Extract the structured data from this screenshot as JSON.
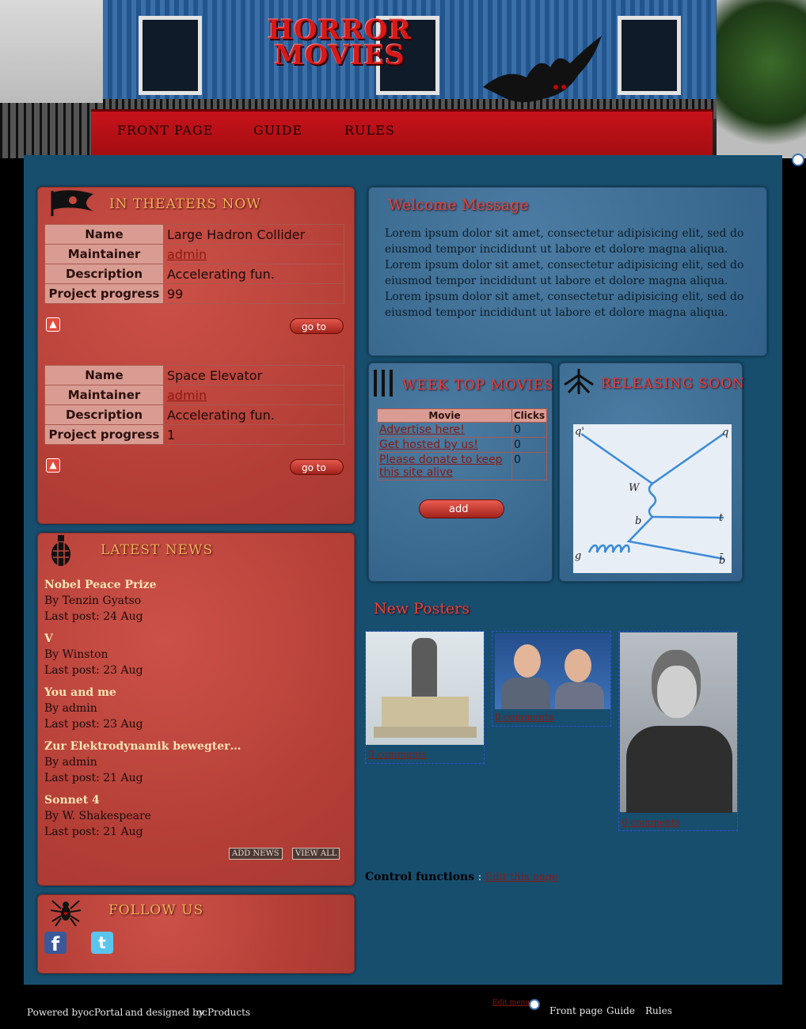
{
  "logo": {
    "line1": "HORROR",
    "line2": "MOVIES"
  },
  "nav": {
    "items": [
      "FRONT PAGE",
      "GUIDE",
      "RULES"
    ]
  },
  "theaters": {
    "title": "IN THEATERS NOW",
    "projects": [
      {
        "fields": [
          {
            "label": "Name",
            "value": "Large Hadron Collider"
          },
          {
            "label": "Maintainer",
            "value": "admin"
          },
          {
            "label": "Description",
            "value": "Accelerating fun."
          },
          {
            "label": "Project progress",
            "value": "99"
          }
        ]
      },
      {
        "fields": [
          {
            "label": "Name",
            "value": "Space Elevator"
          },
          {
            "label": "Maintainer",
            "value": "admin"
          },
          {
            "label": "Description",
            "value": "Accelerating fun."
          },
          {
            "label": "Project progress",
            "value": "1"
          }
        ]
      }
    ],
    "goto_label": "go to"
  },
  "news": {
    "title": "LATEST NEWS",
    "items": [
      {
        "title": "Nobel Peace Prize",
        "by": "By Tenzin Gyatso",
        "date": "Last post: 24 Aug"
      },
      {
        "title": "V",
        "by": "By Winston",
        "date": "Last post: 23 Aug"
      },
      {
        "title": "You and me",
        "by": "By admin",
        "date": "Last post: 23 Aug"
      },
      {
        "title": "Zur Elektrodynamik bewegter…",
        "by": "By admin",
        "date": "Last post: 21 Aug"
      },
      {
        "title": "Sonnet 4",
        "by": "By W. Shakespeare",
        "date": "Last post: 21 Aug"
      }
    ],
    "add_label": "ADD NEWS",
    "view_label": "VIEW ALL"
  },
  "follow": {
    "title": "FOLLOW US",
    "facebook": "f",
    "twitter": "t"
  },
  "welcome": {
    "title": "Welcome Message",
    "text": "Lorem ipsum dolor sit amet, consectetur adipisicing elit, sed do eiusmod tempor incididunt ut labore et dolore magna aliqua. Lorem ipsum dolor sit amet, consectetur adipisicing elit, sed do eiusmod tempor incididunt ut labore et dolore magna aliqua. Lorem ipsum dolor sit amet, consectetur adipisicing elit, sed do eiusmod tempor incididunt ut labore et dolore magna aliqua."
  },
  "week_top": {
    "title": "WEEK TOP MOVIES",
    "headers": [
      "Movie",
      "Clicks"
    ],
    "rows": [
      {
        "movie": "Advertise here!",
        "clicks": "0"
      },
      {
        "movie": "Get hosted by us!",
        "clicks": "0"
      },
      {
        "movie": "Please donate to keep this site alive",
        "clicks": "0"
      }
    ],
    "add_label": "add"
  },
  "releasing": {
    "title": "RELEASING SOON",
    "diagram_labels": {
      "q_prime": "q'",
      "q": "q",
      "w": "W",
      "b": "b",
      "t": "t",
      "g": "g",
      "b_bar": "b̄"
    }
  },
  "posters": {
    "title": "New Posters",
    "items": [
      {
        "comments": "0 comments"
      },
      {
        "comments": "0 comments"
      },
      {
        "comments": "0 comments"
      }
    ]
  },
  "control": {
    "label": "Control functions",
    "sep": ":",
    "link": "Edit this page"
  },
  "footer": {
    "powered": "Powered by",
    "ocportal": "ocPortal",
    "designed": "and designed by",
    "ocproducts": "ocProducts",
    "edit_menu": "Edit menu",
    "links": [
      "Front page",
      "Guide",
      "Rules"
    ]
  },
  "colors": {
    "page_bg": "#174e6e",
    "red_box": "#c1473f",
    "blue_box": "#3a6a8f",
    "accent_red": "#e8413c",
    "gold": "#f2b15c"
  }
}
